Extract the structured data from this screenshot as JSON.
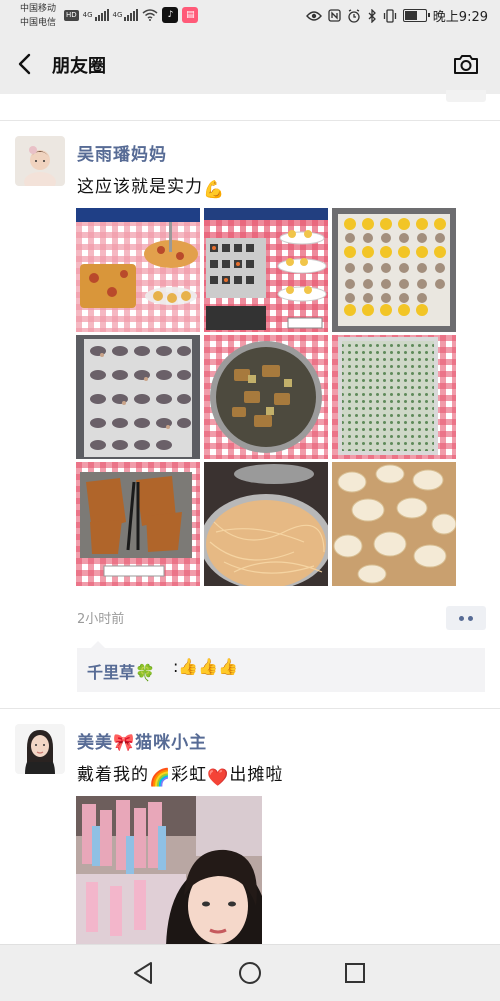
{
  "status_bar": {
    "carrier_1": "中国移动",
    "carrier_2": "中国电信",
    "hd_badge": "HD",
    "net_1": "4G",
    "net_2": "4G",
    "time": "晚上9:29"
  },
  "header": {
    "title": "朋友圈",
    "back_icon": "chevron-left-icon",
    "camera_icon": "camera-icon"
  },
  "posts": [
    {
      "author": "吴雨璠妈妈",
      "text": "这应该就是实力",
      "text_emoji": "💪",
      "photos": [
        "pizza and tarts on stands",
        "sushi rolls and egg tarts",
        "quail eggs and mushrooms",
        "clams on tray",
        "braised pork in pot",
        "scallion pancake on tray",
        "fried fish skewers",
        "noodles in pot",
        "sliced lotus root stew"
      ],
      "time": "2小时前",
      "comment": {
        "author": "千里草🍀",
        "text": ":👍👍👍"
      }
    },
    {
      "author": "美美🎀猫咪小主",
      "text_parts": [
        "戴着我的",
        "🌈",
        "彩虹",
        "❤️",
        "出摊啦"
      ]
    }
  ],
  "nav": {
    "back_icon": "triangle-back-icon",
    "home_icon": "circle-home-icon",
    "recents_icon": "square-recents-icon"
  }
}
